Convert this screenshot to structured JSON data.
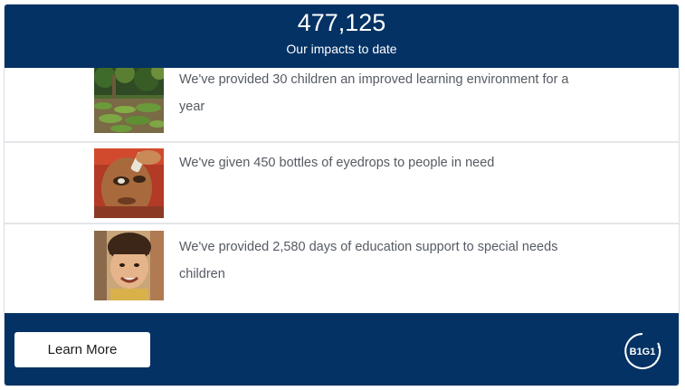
{
  "header": {
    "count": "477,125",
    "subtitle": "Our impacts to date"
  },
  "impacts": [
    {
      "text": "We've provided 30 children an improved learning environment for a year",
      "image": "garden-photo"
    },
    {
      "text": "We've given 450 bottles of eyedrops to people in need",
      "image": "eyedrops-photo"
    },
    {
      "text": "We've provided 2,580 days of education support to special needs children",
      "image": "child-photo"
    }
  ],
  "footer": {
    "button_label": "Learn More",
    "logo_text": "B1G1"
  },
  "colors": {
    "navy": "#043264",
    "text": "#555b63",
    "divider": "#e4e6e9"
  }
}
